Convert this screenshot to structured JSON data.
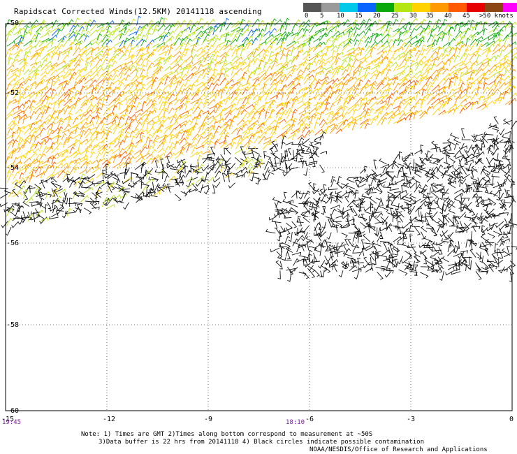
{
  "title": "Rapidscat Corrected Winds(12.5KM) 20141118 ascending",
  "legend": {
    "colors": [
      "#555555",
      "#9a9a9a",
      "#00c8e8",
      "#0a64ff",
      "#0aa80a",
      "#b4e614",
      "#ffd200",
      "#ff9a00",
      "#ff5a00",
      "#e60000",
      "#8b4513",
      "#ff00ff",
      "#9a00c8"
    ],
    "labels": [
      "0",
      "5",
      "10",
      "15",
      "20",
      "25",
      "30",
      "35",
      "40",
      "45",
      ">50 knots"
    ]
  },
  "axes": {
    "lat_labels": [
      "-50",
      "-52",
      "-54",
      "-56",
      "-58",
      "-60"
    ],
    "lon_labels": [
      "-15",
      "-12",
      "-9",
      "-6",
      "-3",
      "0"
    ]
  },
  "time_labels": [
    "19:45",
    "18:10"
  ],
  "notes": [
    "Note: 1) Times are GMT 2)Times along bottom correspond to measurement at ~50S",
    "3)Data buffer is 22 hrs from 20141118 4) Black circles indicate possible contamination"
  ],
  "credit": "NOAA/NESDIS/Office of Research and Applications"
}
